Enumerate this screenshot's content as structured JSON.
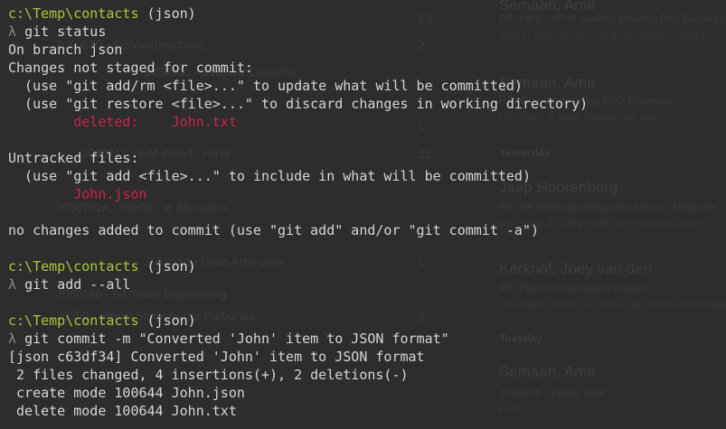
{
  "background_app": {
    "counts": [
      "13",
      "2",
      "1",
      "22",
      "1",
      "2"
    ],
    "left_rows": [
      "2050670 - SiSVoorbeschikte...",
      "2050100 - Subsidie Leidsche",
      "2060717 - BIM Wood - HBW",
      "2050701A - Stedin - te Allocation",
      "2050150 - Deze Actie plan",
      "2050180 - Sif Water Engineering",
      "20550 - Stedin Scopsibuiter Parbarqui"
    ],
    "right_panel": [
      {
        "kind": "sender",
        "text": "Semaan, Amir"
      },
      {
        "kind": "subject",
        "text": "RE: HFS / VP-R overleg Meeting Prio Bilateraal"
      },
      {
        "kind": "preview",
        "text": "Beste, Wat kunnen we omschrijven, maar ik..."
      },
      {
        "kind": "sender",
        "text": "Semaan, Amir"
      },
      {
        "kind": "subject",
        "text": "RE: Overleg Meeting RnD Bilateraal"
      },
      {
        "kind": "preview",
        "text": "Hoi Joey, Ik weet helaas niet wat..."
      },
      {
        "kind": "section",
        "text": "Yesterday"
      },
      {
        "kind": "sender",
        "text": "Jaap Hoorenberg"
      },
      {
        "kind": "subject",
        "text": "RE: SF Stadspat Opsporen Inhuur / Neutrale"
      },
      {
        "kind": "preview",
        "text": "Hoi Joey, Zo zie je hier de stand van zaken..."
      },
      {
        "kind": "sender",
        "text": "Kerkhof, Joey van den"
      },
      {
        "kind": "subject",
        "text": "RE: Heliox Inconsistent project"
      },
      {
        "kind": "preview",
        "text": "Hoi Anton, Dank je. Hier is de nieuwe informatie"
      },
      {
        "kind": "section",
        "text": "Tuesday"
      },
      {
        "kind": "sender",
        "text": "Semaan, Amir"
      },
      {
        "kind": "subject",
        "text": "2050670 - Wodo Tegs"
      },
      {
        "kind": "preview",
        "text": "Hi all,"
      }
    ]
  },
  "terminal": {
    "lines": [
      {
        "type": "prompt",
        "path": "c:\\Temp\\contacts",
        "branch": " (json)"
      },
      {
        "type": "cmd",
        "text": "git status"
      },
      {
        "type": "out",
        "text": "On branch json"
      },
      {
        "type": "out",
        "text": "Changes not staged for commit:"
      },
      {
        "type": "out",
        "text": "  (use \"git add/rm <file>...\" to update what will be committed)"
      },
      {
        "type": "out",
        "text": "  (use \"git restore <file>...\" to discard changes in working directory)"
      },
      {
        "type": "deleted",
        "label": "        deleted:    ",
        "file": "John.txt"
      },
      {
        "type": "blank",
        "text": ""
      },
      {
        "type": "out",
        "text": "Untracked files:"
      },
      {
        "type": "out",
        "text": "  (use \"git add <file>...\" to include in what will be committed)"
      },
      {
        "type": "untracked",
        "text": "        John.json"
      },
      {
        "type": "blank",
        "text": ""
      },
      {
        "type": "out",
        "text": "no changes added to commit (use \"git add\" and/or \"git commit -a\")"
      },
      {
        "type": "blank",
        "text": ""
      },
      {
        "type": "prompt",
        "path": "c:\\Temp\\contacts",
        "branch": " (json)"
      },
      {
        "type": "cmd",
        "text": "git add --all"
      },
      {
        "type": "blank",
        "text": ""
      },
      {
        "type": "prompt",
        "path": "c:\\Temp\\contacts",
        "branch": " (json)"
      },
      {
        "type": "cmd",
        "text": "git commit -m \"Converted 'John' item to JSON format\""
      },
      {
        "type": "out",
        "text": "[json c63df34] Converted 'John' item to JSON format"
      },
      {
        "type": "out",
        "text": " 2 files changed, 4 insertions(+), 2 deletions(-)"
      },
      {
        "type": "out",
        "text": " create mode 100644 John.json"
      },
      {
        "type": "out",
        "text": " delete mode 100644 John.txt"
      }
    ],
    "lambda": "λ",
    "colors": {
      "background": "#2d2d2d",
      "text": "#d6d6d6",
      "path": "#a8c63b",
      "deleted": "#c8254c",
      "lambda": "#8c8c8c"
    }
  }
}
